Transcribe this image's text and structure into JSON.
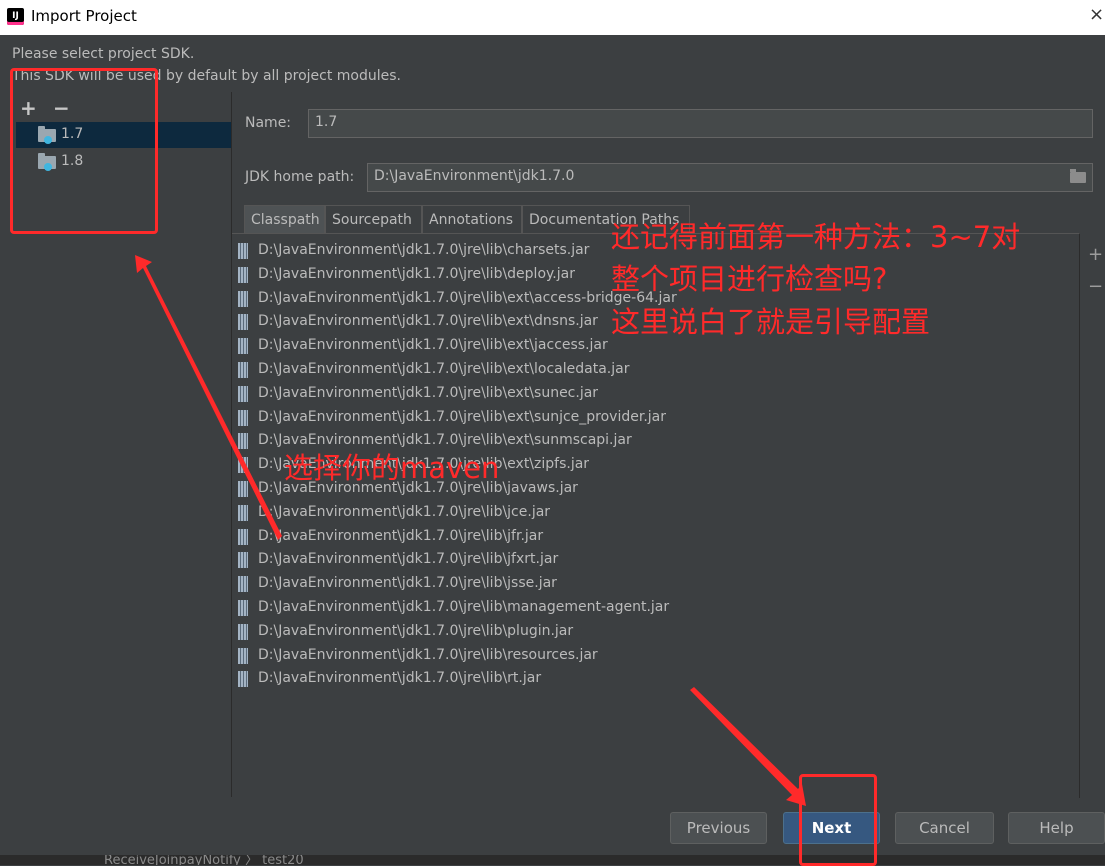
{
  "window": {
    "title": "Import Project",
    "close_glyph": "×"
  },
  "intro": {
    "line1": "Please select project SDK.",
    "line2": "This SDK will be used by default by all project modules."
  },
  "sdk_list": {
    "add_glyph": "+",
    "remove_glyph": "−",
    "items": [
      {
        "label": "1.7",
        "selected": true
      },
      {
        "label": "1.8",
        "selected": false
      }
    ]
  },
  "form": {
    "name_label": "Name:",
    "name_value": "1.7",
    "home_label": "JDK home path:",
    "home_value": "D:\\JavaEnvironment\\jdk1.7.0"
  },
  "tabs": [
    "Classpath",
    "Sourcepath",
    "Annotations",
    "Documentation Paths"
  ],
  "classpath": [
    "D:\\JavaEnvironment\\jdk1.7.0\\jre\\lib\\charsets.jar",
    "D:\\JavaEnvironment\\jdk1.7.0\\jre\\lib\\deploy.jar",
    "D:\\JavaEnvironment\\jdk1.7.0\\jre\\lib\\ext\\access-bridge-64.jar",
    "D:\\JavaEnvironment\\jdk1.7.0\\jre\\lib\\ext\\dnsns.jar",
    "D:\\JavaEnvironment\\jdk1.7.0\\jre\\lib\\ext\\jaccess.jar",
    "D:\\JavaEnvironment\\jdk1.7.0\\jre\\lib\\ext\\localedata.jar",
    "D:\\JavaEnvironment\\jdk1.7.0\\jre\\lib\\ext\\sunec.jar",
    "D:\\JavaEnvironment\\jdk1.7.0\\jre\\lib\\ext\\sunjce_provider.jar",
    "D:\\JavaEnvironment\\jdk1.7.0\\jre\\lib\\ext\\sunmscapi.jar",
    "D:\\JavaEnvironment\\jdk1.7.0\\jre\\lib\\ext\\zipfs.jar",
    "D:\\JavaEnvironment\\jdk1.7.0\\jre\\lib\\javaws.jar",
    "D:\\JavaEnvironment\\jdk1.7.0\\jre\\lib\\jce.jar",
    "D:\\JavaEnvironment\\jdk1.7.0\\jre\\lib\\jfr.jar",
    "D:\\JavaEnvironment\\jdk1.7.0\\jre\\lib\\jfxrt.jar",
    "D:\\JavaEnvironment\\jdk1.7.0\\jre\\lib\\jsse.jar",
    "D:\\JavaEnvironment\\jdk1.7.0\\jre\\lib\\management-agent.jar",
    "D:\\JavaEnvironment\\jdk1.7.0\\jre\\lib\\plugin.jar",
    "D:\\JavaEnvironment\\jdk1.7.0\\jre\\lib\\resources.jar",
    "D:\\JavaEnvironment\\jdk1.7.0\\jre\\lib\\rt.jar"
  ],
  "side_buttons": {
    "add": "+",
    "remove": "−"
  },
  "buttons": {
    "previous": "Previous",
    "next": "Next",
    "cancel": "Cancel",
    "help": "Help"
  },
  "bottombar": {
    "crumbs": "ReceiveJoinpayNotify  〉 test20"
  },
  "annotations": {
    "note1": [
      "还记得前面第一种方法：3~7对",
      "整个项目进行检查吗?",
      "这里说白了就是引导配置"
    ],
    "note2": "选择你的maven",
    "color": "#ff2a2a"
  }
}
